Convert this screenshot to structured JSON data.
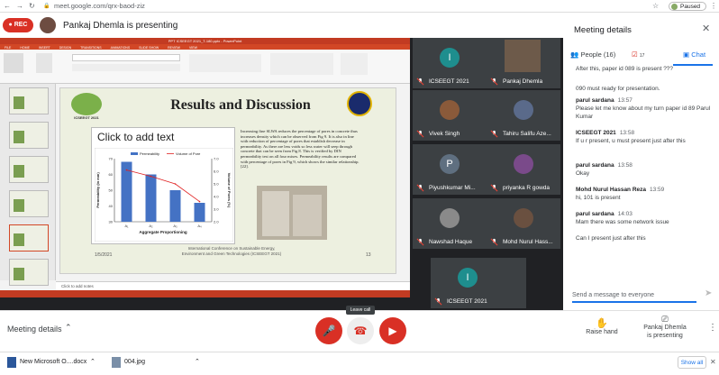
{
  "browser": {
    "url": "meet.google.com/qrx-baod-ziz",
    "profile_status": "Paused"
  },
  "banner": {
    "rec_label": "REC",
    "presenting_text": "Pankaj Dhemla is presenting"
  },
  "ppt": {
    "window_title": "PPT ICSEEGT 2021_T-180.pptx - PowerPoint",
    "tabs": [
      "FILE",
      "HOME",
      "INSERT",
      "DESIGN",
      "TRANSITIONS",
      "ANIMATIONS",
      "SLIDE SHOW",
      "REVIEW",
      "VIEW"
    ],
    "slide": {
      "title": "Results and Discussion",
      "logo_text": "ICSEEGT 2021",
      "placeholder": "Click to add text",
      "paragraph": "Increasing fine SLWA reduces the percentage of pores in concrete thus increases density which can be observed from Fig 9. It is also in line with reduction of percentage of pores that establish decrease in permeability. As there are less voids so less water will seep through concrete that can be seen from Fig 8.  This is verified by DIN permeability test on all four mixes. Permeability results are compared with percentage of pores in Fig 9, which shows the similar relationship. [22].",
      "date": "1/5/2021",
      "conference": "International Conference on Sustainable Energy, Environment and Green Technologies (ICSEEGT 2021)",
      "page": "13"
    },
    "notes_placeholder": "Click to add notes"
  },
  "chart_data": {
    "type": "bar",
    "categories": [
      "A₁",
      "A₂",
      "A₃",
      "A₄"
    ],
    "series": [
      {
        "name": "Permeability",
        "type": "bar",
        "values": [
          68,
          60,
          50,
          42
        ]
      },
      {
        "name": "Volume of Pore",
        "type": "line",
        "values": [
          6.1,
          5.6,
          5.0,
          3.6
        ]
      }
    ],
    "xlabel": "Aggregate Proportioning",
    "ylabel": "Permeability (in mm)",
    "y2label": "Volume of Pores (%)",
    "ylim": [
      30,
      70
    ],
    "y2lim": [
      2,
      7
    ],
    "colors": {
      "bars": "#4472c4",
      "line": "#e02020"
    }
  },
  "participants": [
    {
      "name": "ICSEEGT 2021",
      "initial": "I",
      "color": "#1e8e8e"
    },
    {
      "name": "Pankaj Dhemla",
      "initial": "",
      "color": "#6d5a4a"
    },
    {
      "name": "Vivek Singh",
      "initial": "",
      "color": "#8a5a3a"
    },
    {
      "name": "Tahiru Salifu Aze...",
      "initial": "",
      "color": "#5a6a8a"
    },
    {
      "name": "Piyushkumar Mi...",
      "initial": "P",
      "color": "#5f6f80"
    },
    {
      "name": "priyanka R gowda",
      "initial": "",
      "color": "#7a4a8a"
    },
    {
      "name": "Nawshad Haque",
      "initial": "",
      "color": "#8a8a8a"
    },
    {
      "name": "Mohd Nurul Hass...",
      "initial": "",
      "color": "#6a5040"
    },
    {
      "name": "ICSEEGT 2021",
      "initial": "I",
      "color": "#1e8e8e"
    }
  ],
  "panel": {
    "title": "Meeting details",
    "tabs": {
      "people": "People (16)",
      "activities_count": "17",
      "chat": "Chat"
    },
    "messages": [
      {
        "text": "After this, paper id 089 is present ???"
      },
      {
        "text": "090 must ready for presentation."
      },
      {
        "who": "parul sardana",
        "time": "13:57",
        "text": "Please let me know about my turn paper id  89 Parul Kumar"
      },
      {
        "who": "ICSEEGT 2021",
        "time": "13:58",
        "text": "If u r present, u must present just after this"
      },
      {
        "who": "parul sardana",
        "time": "13:58",
        "text": "Okay"
      },
      {
        "who": "Mohd Nurul Hassan Reza",
        "time": "13:59",
        "text": "hi, 101 is present"
      },
      {
        "who": "parul sardana",
        "time": "14:03",
        "text": "Mam there was some network issue"
      },
      {
        "text": "Can I present just after this"
      }
    ],
    "send_placeholder": "Send a message to everyone"
  },
  "bottom": {
    "meeting_details": "Meeting details",
    "leave_tooltip": "Leave call",
    "raise_hand": "Raise hand",
    "presenting": "Pankaj Dhemla is presenting"
  },
  "downloads": {
    "items": [
      "New Microsoft O....docx",
      "004.jpg"
    ],
    "show_all": "Show all"
  }
}
